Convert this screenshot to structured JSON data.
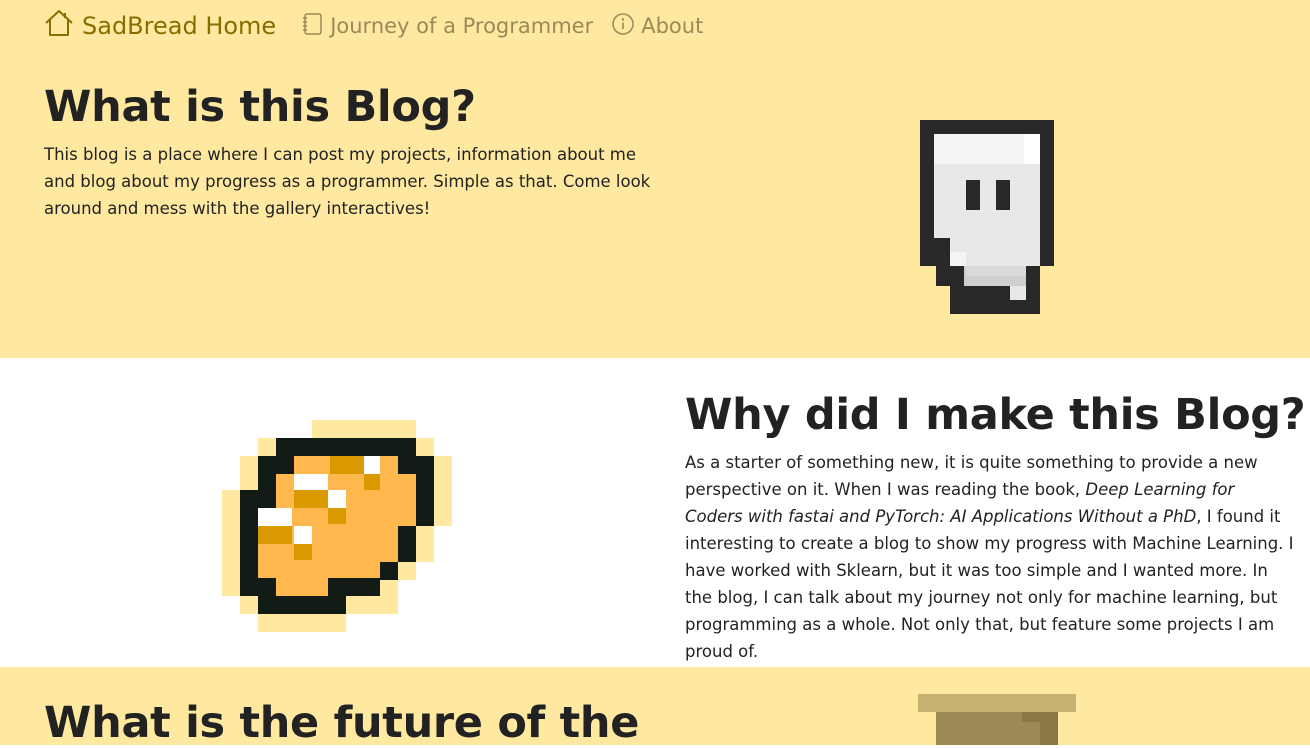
{
  "nav": {
    "home_label": "SadBread Home",
    "journey_label": "Journey of a Programmer",
    "about_label": "About",
    "home_icon": "home-icon",
    "journey_icon": "notebook-icon",
    "about_icon": "info-icon"
  },
  "sections": [
    {
      "title": "What is this Blog?",
      "text": "This blog is a place where I can post my projects, information about me and blog about my progress as a programmer. Simple as that. Come look around and mess with the gallery interactives!",
      "image": "pixel-ghost"
    },
    {
      "title": "Why did I make this Blog?",
      "text_before": "As a starter of something new, it is quite something to provide a new perspective on it. When I was reading the book, ",
      "book_title": "Deep Learning for Coders with fastai and PyTorch: AI Applications Without a PhD",
      "text_after": ", I found it interesting to create a blog to show my progress with Machine Learning. I have worked with Sklearn, but it was too simple and I wanted more. In the blog, I can talk about my journey not only for machine learning, but programming as a whole. Not only that, but feature some projects I am proud of.",
      "image": "pixel-bread"
    },
    {
      "title": "What is the future of the",
      "image": "pixel-box"
    }
  ],
  "colors": {
    "band_yellow": "#ffe9a0",
    "brand": "#8a6d00",
    "nav_link": "#9a8a5a",
    "bread_fill": "#ffb84d",
    "bread_crust": "#d99a00"
  }
}
